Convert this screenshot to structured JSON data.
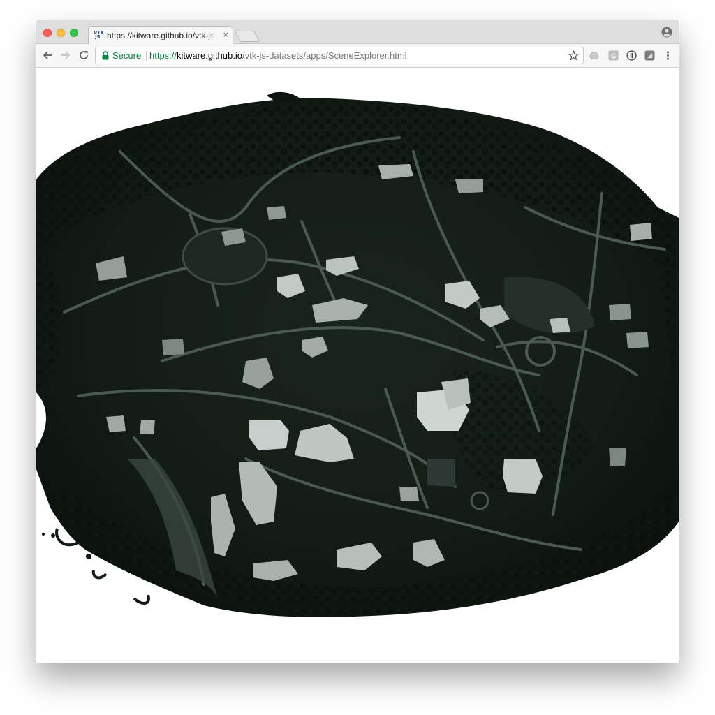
{
  "browser": {
    "tab": {
      "favicon_text": "VTK JS",
      "title": "https://kitware.github.io/vtk-js",
      "close_glyph": "×"
    },
    "address_bar": {
      "security_label": "Secure",
      "url_scheme": "https://",
      "url_host": "kitware.github.io",
      "url_path": "/vtk-js-datasets/apps/SceneExplorer.html"
    },
    "icons": [
      "back-icon",
      "forward-icon",
      "reload-icon",
      "lock-icon",
      "bookmark-star-icon",
      "extension-drive-icon",
      "extension-g-icon",
      "extension-info-icon",
      "extension-square-icon",
      "menu-icon",
      "profile-icon"
    ]
  },
  "scene": {
    "description_type": "3D textured terrain mesh of a campus rendered in vtk.js",
    "colors": {
      "terrain": "#141d17",
      "vegetation": "#0d130f",
      "roads": "#4b5a53",
      "buildings": "#c9d0cc",
      "background": "#ffffff"
    }
  }
}
